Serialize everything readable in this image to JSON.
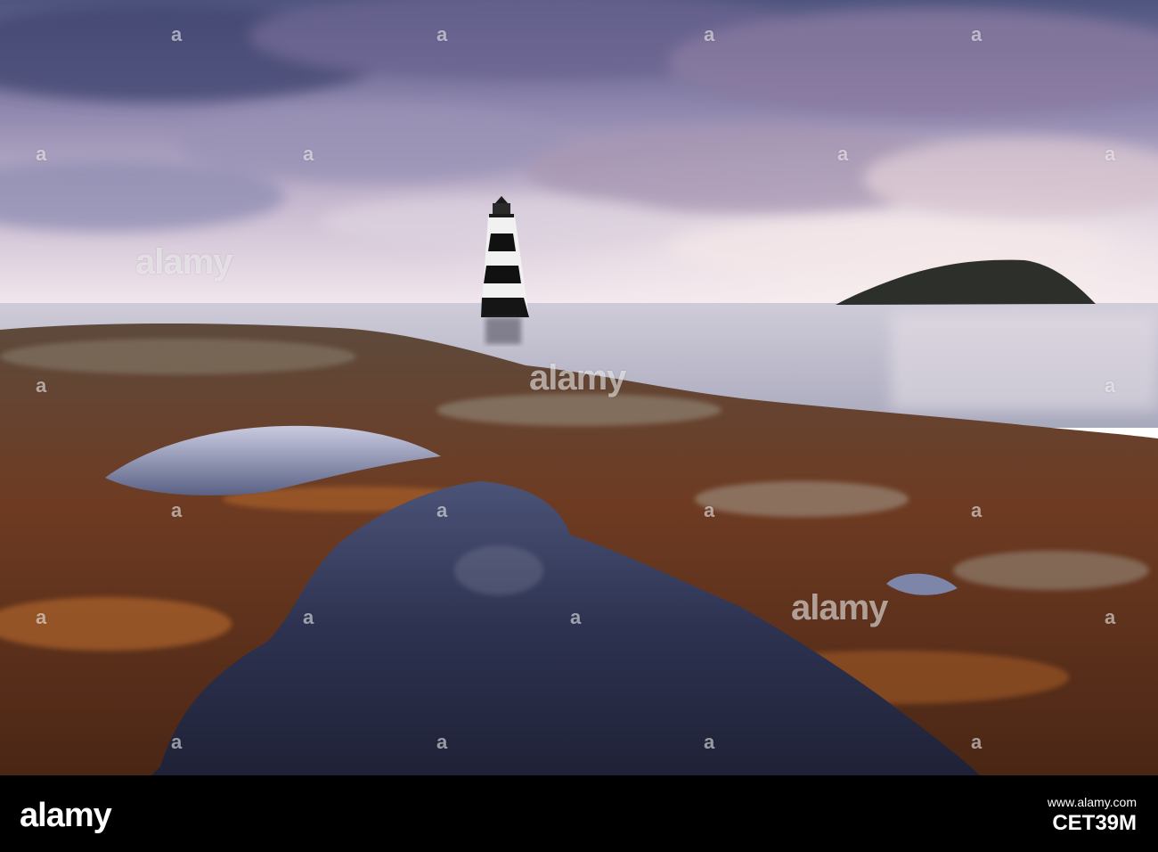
{
  "watermark": {
    "brand": "alamy",
    "small_mark": "a"
  },
  "footer": {
    "logo": "alamy",
    "link": "www.alamy.com",
    "image_id": "CET39M"
  },
  "colors": {
    "sky_top": "#5a5f8c",
    "sky_mid": "#b8a9c6",
    "horizon": "#efe5ec",
    "sea": "#c9c6d3",
    "seaweed": "#7a3f22",
    "pool": "#2e3452",
    "footer_bg": "#000000"
  }
}
